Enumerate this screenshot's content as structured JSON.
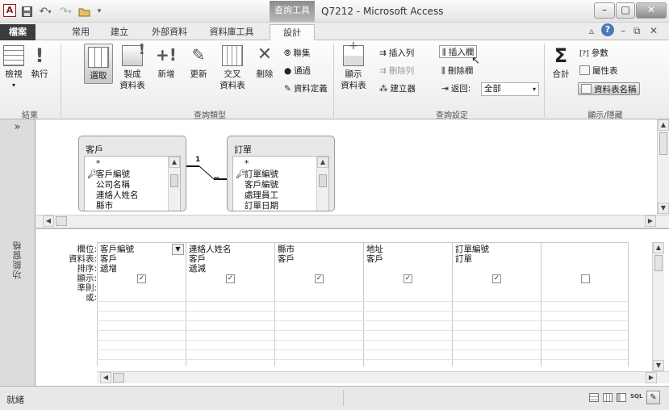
{
  "titlebar": {
    "app_icon": "A",
    "context_tab_title": "查詢工具",
    "window_title": "Q7212 - Microsoft Access",
    "qat_icons": [
      "save-icon",
      "undo-icon",
      "redo-icon",
      "folder-icon",
      "customize-icon"
    ]
  },
  "tabs": {
    "file": "檔案",
    "home": "常用",
    "create": "建立",
    "external": "外部資料",
    "dbtools": "資料庫工具",
    "design": "設計"
  },
  "ribbon": {
    "results": {
      "view": "檢視",
      "run": "執行",
      "group_label": "結果"
    },
    "query_type": {
      "select": "選取",
      "make_table": "製成\n資料表",
      "append": "新增",
      "update": "更新",
      "crosstab": "交叉\n資料表",
      "delete": "刪除",
      "union": "聯集",
      "passthrough": "通過",
      "data_definition": "資料定義",
      "group_label": "查詢類型"
    },
    "query_setup": {
      "show_table": "顯示\n資料表",
      "insert_rows": "插入列",
      "delete_rows": "刪除列",
      "builder": "建立器",
      "insert_columns": "插入欄",
      "delete_columns": "刪除欄",
      "return_label": "返回:",
      "return_value": "全部",
      "group_label": "查詢設定"
    },
    "show_hide": {
      "totals": "合計",
      "parameters": "參數",
      "property_sheet": "屬性表",
      "table_names": "資料表名稱",
      "group_label": "顯示/隱藏"
    }
  },
  "navpane": {
    "chevron": "»",
    "label": "功能窗格"
  },
  "diagram": {
    "customers": {
      "title": "客戶",
      "fields": [
        "*",
        "客戶編號",
        "公司名稱",
        "連絡人姓名",
        "縣市"
      ]
    },
    "orders": {
      "title": "訂單",
      "fields": [
        "*",
        "訂單編號",
        "客戶編號",
        "處理員工",
        "訂單日期"
      ]
    },
    "relationship": {
      "one": "1",
      "many": "∞"
    }
  },
  "grid": {
    "row_labels": [
      "欄位:",
      "資料表:",
      "排序:",
      "顯示:",
      "準則:",
      "或:"
    ],
    "columns": [
      {
        "field": "客戶編號",
        "table": "客戶",
        "sort": "遞增",
        "show": true
      },
      {
        "field": "連絡人姓名",
        "table": "客戶",
        "sort": "遞減",
        "show": true
      },
      {
        "field": "縣市",
        "table": "客戶",
        "sort": "",
        "show": true
      },
      {
        "field": "地址",
        "table": "客戶",
        "sort": "",
        "show": true
      },
      {
        "field": "訂單編號",
        "table": "訂單",
        "sort": "",
        "show": true
      },
      {
        "field": "",
        "table": "",
        "sort": "",
        "show": false
      }
    ]
  },
  "status": {
    "text": "就緒",
    "view_icons": [
      "datasheet-view-icon",
      "pivottable-view-icon",
      "pivotchart-view-icon",
      "sql-view-icon",
      "design-view-icon"
    ],
    "sql_label": "SQL"
  }
}
